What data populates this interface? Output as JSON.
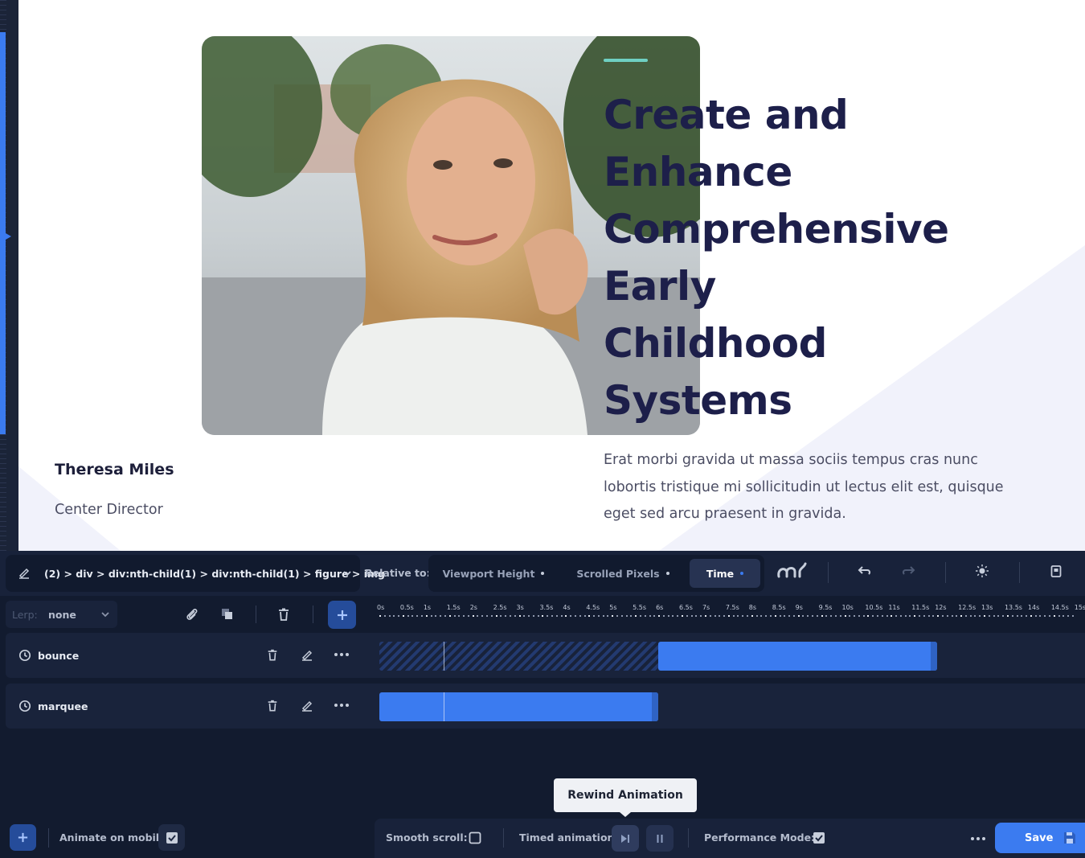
{
  "preview": {
    "hero": {
      "title_lines": [
        "Create and",
        "Enhance",
        "Comprehensive",
        "Early",
        "Childhood",
        "Systems"
      ],
      "description": "Erat morbi gravida ut massa sociis tempus cras nunc lobortis tristique mi sollicitudin ut lectus elit est, quisque eget sed arcu praesent in gravida."
    },
    "person": {
      "name": "Theresa Miles",
      "role": "Center Director"
    },
    "colors": {
      "title": "#1d1f4a",
      "accent_line": "#6fd0c3"
    }
  },
  "editor": {
    "selector_path": "(2) > div > div:nth-child(1) > div:nth-child(1) > figure > img",
    "relative_label": "Relative to:",
    "relative_options": [
      {
        "label": "Viewport Height",
        "active": false
      },
      {
        "label": "Scrolled Pixels",
        "active": false
      },
      {
        "label": "Time",
        "active": true
      }
    ],
    "lerp": {
      "label": "Lerp:",
      "value": "none"
    },
    "timeline_ticks": [
      "0s",
      "0.5s",
      "1s",
      "1.5s",
      "2s",
      "2.5s",
      "3s",
      "3.5s",
      "4s",
      "4.5s",
      "5s",
      "5.5s",
      "6s",
      "6.5s",
      "7s",
      "7.5s",
      "8s",
      "8.5s",
      "9s",
      "9.5s",
      "10s",
      "10.5s",
      "11s",
      "11.5s",
      "12s",
      "12.5s",
      "13s",
      "13.5s",
      "14s",
      "14.5s",
      "15s"
    ],
    "animations": [
      {
        "name": "bounce",
        "delay_s": 6,
        "duration_s": 6
      },
      {
        "name": "marquee",
        "delay_s": 0,
        "duration_s": 6
      }
    ],
    "tooltip": "Rewind Animation",
    "bottom": {
      "animate_on_mobile_label": "Animate on mobile:",
      "animate_on_mobile": true,
      "smooth_scroll_label": "Smooth scroll:",
      "smooth_scroll": false,
      "timed_animation_label": "Timed animation:",
      "performance_mode_label": "Performance Mode:",
      "performance_mode": true,
      "save_label": "Save"
    },
    "colors": {
      "accent": "#3b7bf0",
      "panel_bg": "#121b2f",
      "row_bg": "#19233b"
    }
  }
}
